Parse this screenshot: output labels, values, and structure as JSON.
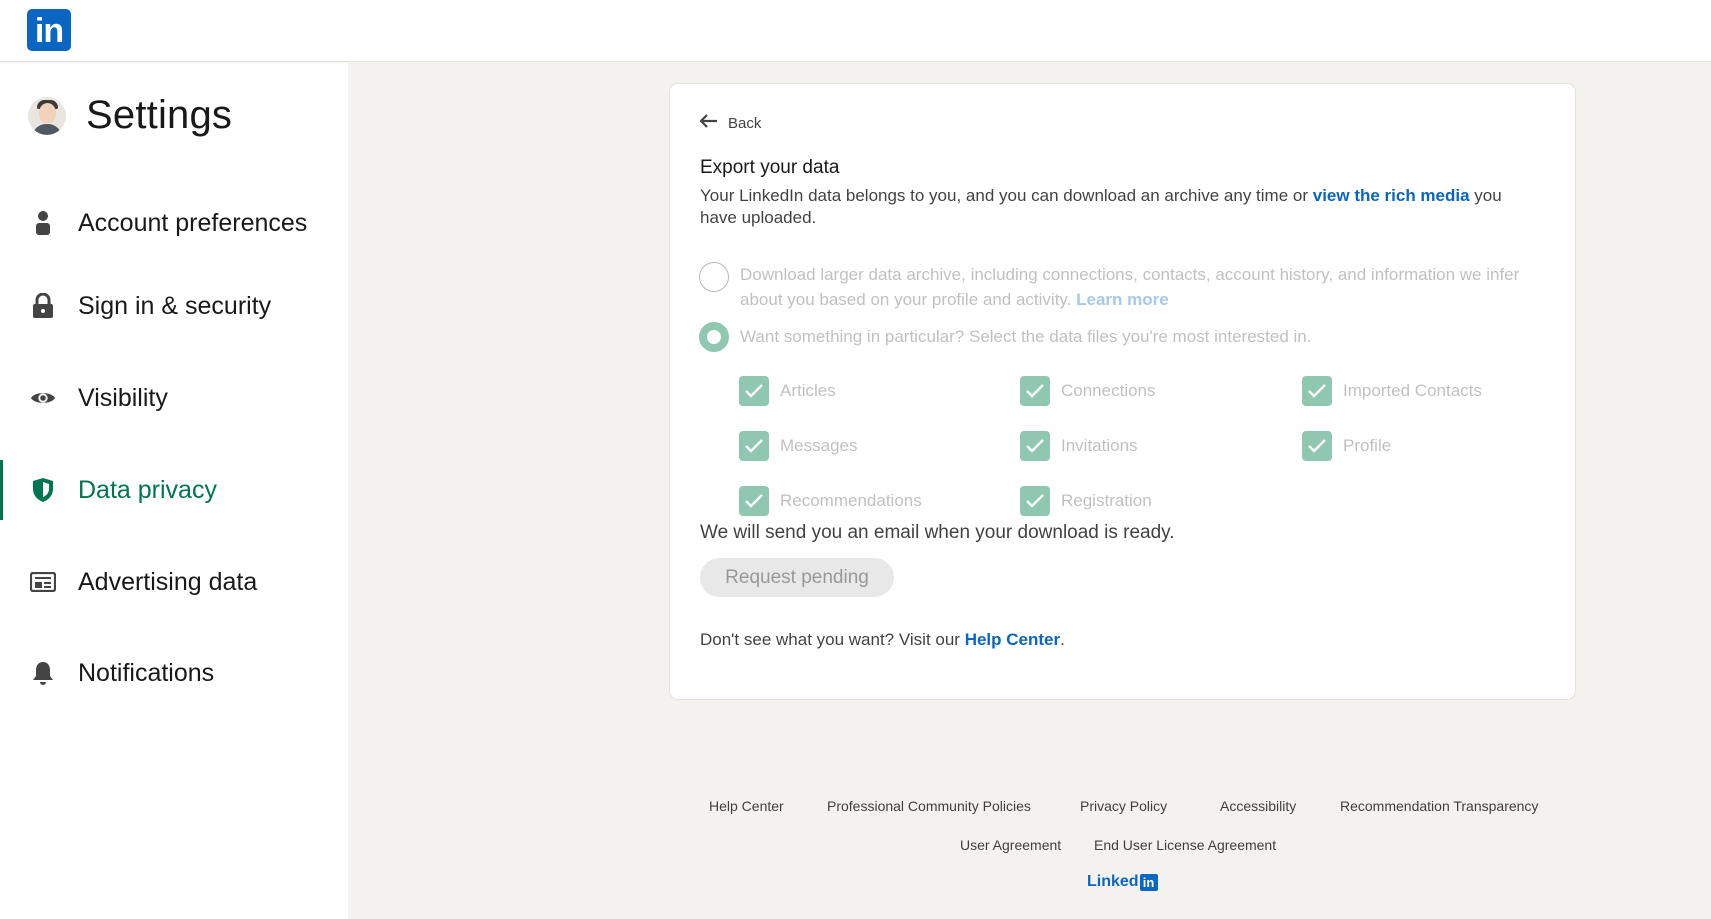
{
  "header": {
    "logo_text": "in"
  },
  "sidebar": {
    "title": "Settings",
    "items": [
      {
        "label": "Account preferences",
        "icon": "person-icon"
      },
      {
        "label": "Sign in & security",
        "icon": "lock-icon"
      },
      {
        "label": "Visibility",
        "icon": "eye-icon"
      },
      {
        "label": "Data privacy",
        "icon": "shield-icon",
        "active": true
      },
      {
        "label": "Advertising data",
        "icon": "ad-card-icon"
      },
      {
        "label": "Notifications",
        "icon": "bell-icon"
      }
    ]
  },
  "card": {
    "back_label": "Back",
    "title": "Export your data",
    "desc_prefix": "Your LinkedIn data belongs to you, and you can download an archive any time or ",
    "desc_link": "view the rich media",
    "desc_suffix": " you have uploaded.",
    "option_full": {
      "text": "Download larger data archive, including connections, contacts, account history, and information we infer about you based on your profile and activity. ",
      "link": "Learn more",
      "selected": false
    },
    "option_partial": {
      "text": "Want something in particular? Select the data files you're most interested in.",
      "selected": true
    },
    "files": [
      {
        "label": "Articles",
        "checked": true
      },
      {
        "label": "Connections",
        "checked": true
      },
      {
        "label": "Imported Contacts",
        "checked": true
      },
      {
        "label": "Messages",
        "checked": true
      },
      {
        "label": "Invitations",
        "checked": true
      },
      {
        "label": "Profile",
        "checked": true
      },
      {
        "label": "Recommendations",
        "checked": true
      },
      {
        "label": "Registration",
        "checked": true
      }
    ],
    "notice": "We will send you an email when your download is ready.",
    "pending_button": "Request pending",
    "help_prefix": "Don't see what you want? Visit our ",
    "help_link": "Help Center",
    "help_suffix": "."
  },
  "footer": {
    "links": [
      "Help Center",
      "Professional Community Policies",
      "Privacy Policy",
      "Accessibility",
      "Recommendation Transparency",
      "User Agreement",
      "End User License Agreement"
    ],
    "brand_text": "Linked",
    "brand_box": "in"
  },
  "colors": {
    "brand": "#0a66c2",
    "active_green": "#01754f",
    "checkbox_fill": "#8fc7b0",
    "page_bg": "#f4f2ee"
  }
}
